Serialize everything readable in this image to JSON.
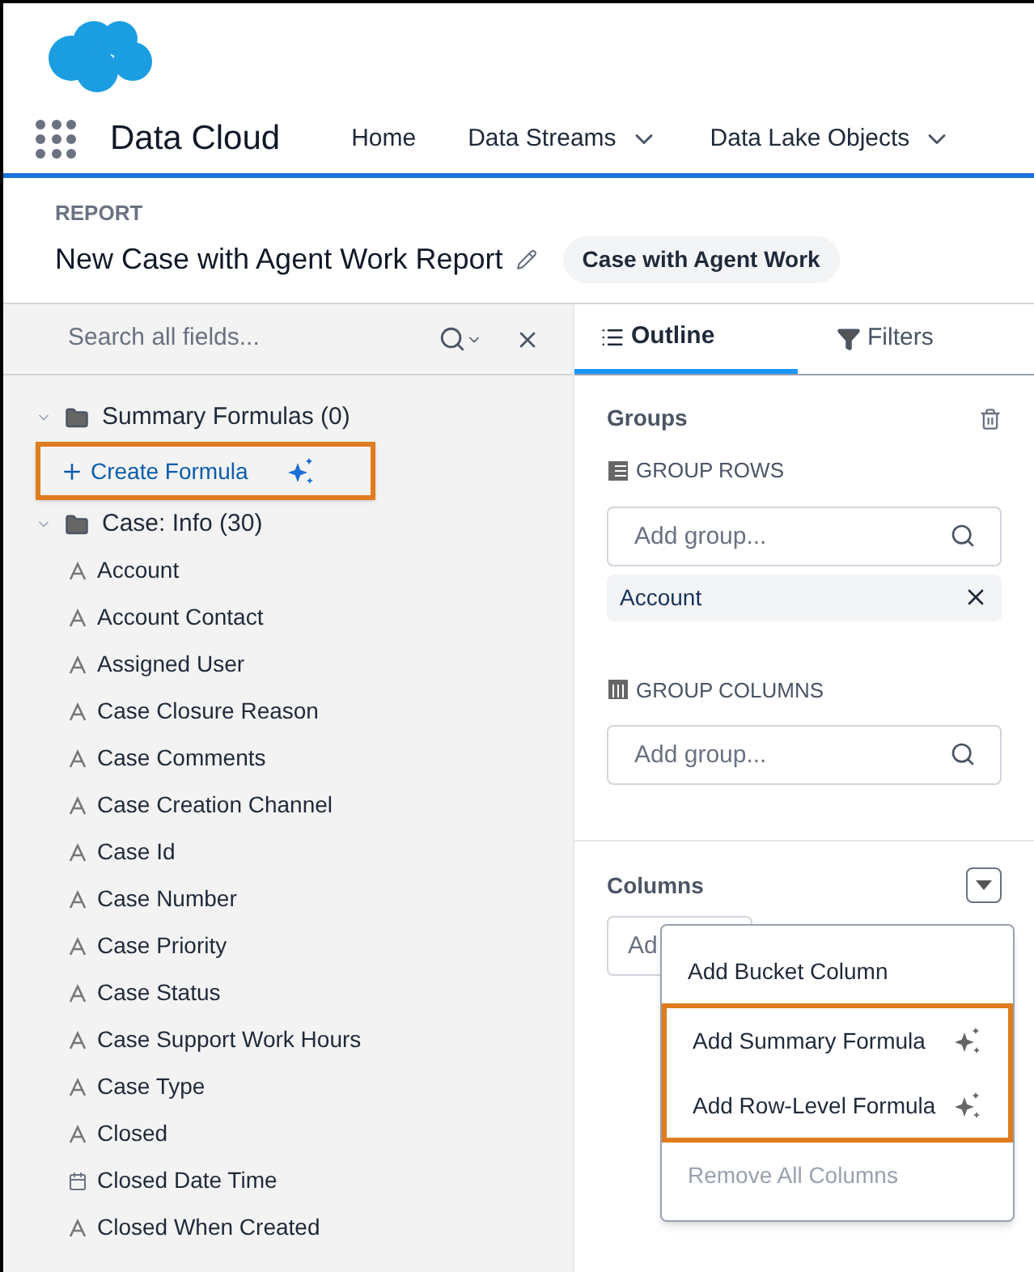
{
  "app": {
    "name": "Data Cloud"
  },
  "nav": [
    {
      "label": "Home",
      "dropdown": false
    },
    {
      "label": "Data Streams",
      "dropdown": true
    },
    {
      "label": "Data Lake Objects",
      "dropdown": true
    }
  ],
  "report": {
    "label": "REPORT",
    "title": "New Case with Agent Work Report",
    "type_badge": "Case with Agent Work"
  },
  "fields_panel": {
    "search": {
      "placeholder": "Search all fields..."
    },
    "folders": [
      {
        "name": "Summary Formulas (0)",
        "expanded": true,
        "action": {
          "label": "Create Formula",
          "highlighted": true
        }
      },
      {
        "name": "Case: Info (30)",
        "expanded": true,
        "children": [
          {
            "label": "Account",
            "kind": "text"
          },
          {
            "label": "Account Contact",
            "kind": "text"
          },
          {
            "label": "Assigned User",
            "kind": "text"
          },
          {
            "label": "Case Closure Reason",
            "kind": "text"
          },
          {
            "label": "Case Comments",
            "kind": "text"
          },
          {
            "label": "Case Creation Channel",
            "kind": "text"
          },
          {
            "label": "Case Id",
            "kind": "text"
          },
          {
            "label": "Case Number",
            "kind": "text"
          },
          {
            "label": "Case Priority",
            "kind": "text"
          },
          {
            "label": "Case Status",
            "kind": "text"
          },
          {
            "label": "Case Support Work Hours",
            "kind": "text"
          },
          {
            "label": "Case Type",
            "kind": "text"
          },
          {
            "label": "Closed",
            "kind": "text"
          },
          {
            "label": "Closed Date Time",
            "kind": "date"
          },
          {
            "label": "Closed When Created",
            "kind": "text"
          }
        ]
      }
    ]
  },
  "tabs": [
    {
      "label": "Outline",
      "selected": true,
      "kind": "list"
    },
    {
      "label": "Filters",
      "selected": false,
      "kind": "filter"
    }
  ],
  "groups": {
    "title": "Groups",
    "rows": {
      "label": "GROUP ROWS",
      "placeholder": "Add group...",
      "items": [
        "Account"
      ]
    },
    "columns": {
      "label": "GROUP COLUMNS",
      "placeholder": "Add group..."
    }
  },
  "columns": {
    "title": "Columns",
    "field_placeholder": "Ad",
    "menu": [
      {
        "label": "Add Bucket Column",
        "ai": false,
        "disabled": false,
        "highlighted": false
      },
      {
        "label": "Add Summary Formula",
        "ai": true,
        "disabled": false,
        "highlighted": true
      },
      {
        "label": "Add Row-Level Formula",
        "ai": true,
        "disabled": false,
        "highlighted": true
      },
      {
        "label": "Remove All Columns",
        "ai": false,
        "disabled": true,
        "highlighted": false
      }
    ]
  }
}
